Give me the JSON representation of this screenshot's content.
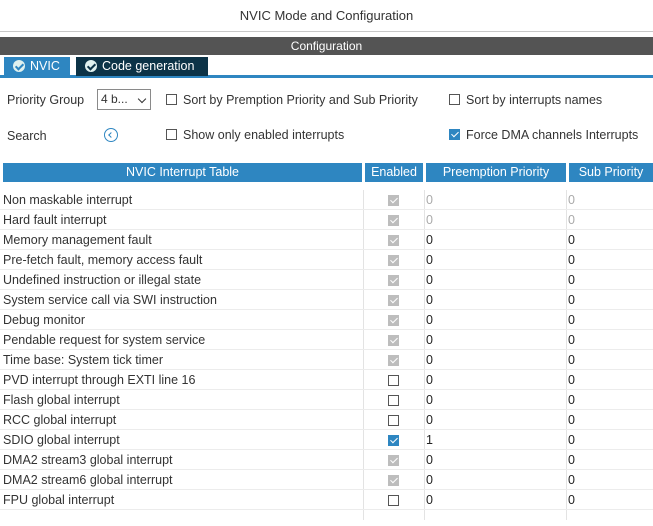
{
  "window": {
    "title": "NVIC Mode and Configuration"
  },
  "config_bar": {
    "label": "Configuration"
  },
  "tabs": [
    {
      "label": "NVIC",
      "active": true
    },
    {
      "label": "Code generation",
      "active": false
    }
  ],
  "controls": {
    "priority_group_label": "Priority Group",
    "priority_group_value": "4 b...",
    "sort_preemption_label": "Sort by Premption Priority and Sub Priority",
    "sort_preemption_checked": false,
    "sort_names_label": "Sort by interrupts names",
    "sort_names_checked": false,
    "search_label": "Search",
    "show_enabled_label": "Show only enabled interrupts",
    "show_enabled_checked": false,
    "force_dma_label": "Force DMA channels Interrupts",
    "force_dma_checked": true
  },
  "table": {
    "headers": {
      "name": "NVIC Interrupt Table",
      "enabled": "Enabled",
      "preemption": "Preemption Priority",
      "sub": "Sub Priority"
    },
    "rows": [
      {
        "name": "Non maskable interrupt",
        "enabled": "locked",
        "preemption": "0",
        "sub": "0",
        "editable": false
      },
      {
        "name": "Hard fault interrupt",
        "enabled": "locked",
        "preemption": "0",
        "sub": "0",
        "editable": false
      },
      {
        "name": "Memory management fault",
        "enabled": "locked",
        "preemption": "0",
        "sub": "0",
        "editable": true
      },
      {
        "name": "Pre-fetch fault, memory access fault",
        "enabled": "locked",
        "preemption": "0",
        "sub": "0",
        "editable": true
      },
      {
        "name": "Undefined instruction or illegal state",
        "enabled": "locked",
        "preemption": "0",
        "sub": "0",
        "editable": true
      },
      {
        "name": "System service call via SWI instruction",
        "enabled": "locked",
        "preemption": "0",
        "sub": "0",
        "editable": true
      },
      {
        "name": "Debug monitor",
        "enabled": "locked",
        "preemption": "0",
        "sub": "0",
        "editable": true
      },
      {
        "name": "Pendable request for system service",
        "enabled": "locked",
        "preemption": "0",
        "sub": "0",
        "editable": true
      },
      {
        "name": "Time base: System tick timer",
        "enabled": "locked",
        "preemption": "0",
        "sub": "0",
        "editable": true
      },
      {
        "name": "PVD interrupt through EXTI line 16",
        "enabled": "off",
        "preemption": "0",
        "sub": "0",
        "editable": true
      },
      {
        "name": "Flash global interrupt",
        "enabled": "off",
        "preemption": "0",
        "sub": "0",
        "editable": true
      },
      {
        "name": "RCC global interrupt",
        "enabled": "off",
        "preemption": "0",
        "sub": "0",
        "editable": true
      },
      {
        "name": "SDIO global interrupt",
        "enabled": "on",
        "preemption": "1",
        "sub": "0",
        "editable": true
      },
      {
        "name": "DMA2 stream3 global interrupt",
        "enabled": "locked",
        "preemption": "0",
        "sub": "0",
        "editable": true
      },
      {
        "name": "DMA2 stream6 global interrupt",
        "enabled": "locked",
        "preemption": "0",
        "sub": "0",
        "editable": true
      },
      {
        "name": "FPU global interrupt",
        "enabled": "off",
        "preemption": "0",
        "sub": "0",
        "editable": true
      }
    ]
  },
  "colors": {
    "accent": "#2e86c1",
    "header_bar": "#545454",
    "tab_dark": "#0c3347",
    "locked_check": "#bdbdbd"
  }
}
